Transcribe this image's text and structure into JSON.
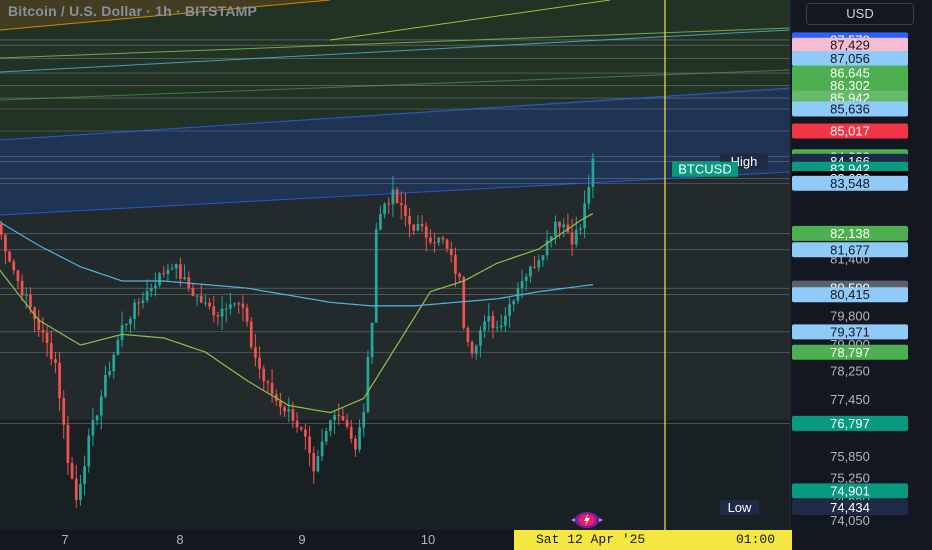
{
  "header": {
    "title": "Bitcoin / U.S. Dollar · 1h · BITSTAMP",
    "currency_button": "USD"
  },
  "crosshair": {
    "date_label": "Sat 12 Apr '25",
    "time_label": "01:00"
  },
  "colors": {
    "background": "#131722",
    "up": "#26a69a",
    "down": "#ef5350",
    "crosshair": "#f5e642",
    "ma_fast": "#8bc34a",
    "ma_slow": "#4db6e6"
  },
  "chart_data": {
    "type": "candlestick",
    "symbol": "BTCUSD",
    "x_ticks": [
      "7",
      "8",
      "9",
      "10"
    ],
    "y_ticks": [
      87578,
      87429,
      87056,
      86645,
      86302,
      85942,
      85636,
      85017,
      84293,
      84166,
      83942,
      83683,
      83548,
      82138,
      81677,
      81400,
      80599,
      80415,
      79800,
      79371,
      79000,
      78797,
      78250,
      77450,
      76797,
      75850,
      75250,
      74901,
      74650,
      74434,
      74050
    ],
    "price_labels": [
      {
        "value": 87578,
        "text": "87,578",
        "color": "#2962ff"
      },
      {
        "value": 87429,
        "text": "87,429",
        "color": "#f8bbd0"
      },
      {
        "value": 87056,
        "text": "87,056",
        "color": "#90caf9"
      },
      {
        "value": 86645,
        "text": "86,645",
        "color": "#4caf50"
      },
      {
        "value": 86302,
        "text": "86,302",
        "color": "#4caf50"
      },
      {
        "value": 85942,
        "text": "85,942",
        "color": "#66bb6a"
      },
      {
        "value": 85636,
        "text": "85,636",
        "color": "#90caf9"
      },
      {
        "value": 85017,
        "text": "85,017",
        "color": "#f23645"
      },
      {
        "value": 84293,
        "text": "84,293",
        "color": "#4caf50"
      },
      {
        "value": 84166,
        "text": "84,166",
        "color": "#1e2a46",
        "tag": "High"
      },
      {
        "value": 83942,
        "text": "83,942",
        "color": "#089981",
        "tag": "BTCUSD"
      },
      {
        "value": 83683,
        "text": "83,683",
        "color": "#000000"
      },
      {
        "value": 83548,
        "text": "83,548",
        "color": "#90caf9"
      },
      {
        "value": 82138,
        "text": "82,138",
        "color": "#4caf50"
      },
      {
        "value": 81677,
        "text": "81,677",
        "color": "#90caf9"
      },
      {
        "value": 80599,
        "text": "80,599",
        "color": "#5d606b"
      },
      {
        "value": 80415,
        "text": "80,415",
        "color": "#90caf9"
      },
      {
        "value": 79371,
        "text": "79,371",
        "color": "#90caf9"
      },
      {
        "value": 78797,
        "text": "78,797",
        "color": "#4caf50"
      },
      {
        "value": 76797,
        "text": "76,797",
        "color": "#089981"
      },
      {
        "value": 74901,
        "text": "74,901",
        "color": "#089981"
      },
      {
        "value": 74434,
        "text": "74,434",
        "color": "#1e2a46",
        "tag": "Low"
      }
    ],
    "axis_plain_labels": [
      {
        "value": 81400,
        "text": "81,400"
      },
      {
        "value": 79800,
        "text": "79,800"
      },
      {
        "value": 79000,
        "text": "79,000"
      },
      {
        "value": 78250,
        "text": "78,250"
      },
      {
        "value": 77450,
        "text": "77,450"
      },
      {
        "value": 75850,
        "text": "75,850"
      },
      {
        "value": 75250,
        "text": "75,250"
      },
      {
        "value": 74650,
        "text": "74,650"
      },
      {
        "value": 74050,
        "text": "74,050"
      }
    ],
    "horizontal_levels": [
      87578,
      87429,
      87056,
      86645,
      86302,
      85942,
      85636,
      85017,
      84293,
      84166,
      83683,
      83548,
      82138,
      81677,
      80599,
      80415,
      79371,
      78797,
      76797
    ],
    "ylim": [
      73800,
      88700
    ],
    "anchors": [
      [
        0,
        82400
      ],
      [
        5,
        80800
      ],
      [
        10,
        79500
      ],
      [
        14,
        78500
      ],
      [
        17,
        75800
      ],
      [
        19,
        74650
      ],
      [
        22,
        76300
      ],
      [
        26,
        78000
      ],
      [
        30,
        79500
      ],
      [
        34,
        80200
      ],
      [
        38,
        80800
      ],
      [
        42,
        81300
      ],
      [
        46,
        80600
      ],
      [
        50,
        80100
      ],
      [
        53,
        79900
      ],
      [
        56,
        80300
      ],
      [
        59,
        80000
      ],
      [
        61,
        79000
      ],
      [
        64,
        78000
      ],
      [
        67,
        77450
      ],
      [
        71,
        77000
      ],
      [
        74,
        76300
      ],
      [
        76,
        75300
      ],
      [
        78,
        76200
      ],
      [
        81,
        77200
      ],
      [
        84,
        76800
      ],
      [
        86,
        76000
      ],
      [
        88,
        77200
      ],
      [
        90,
        79800
      ],
      [
        91,
        82300
      ],
      [
        93,
        83000
      ],
      [
        95,
        83200
      ],
      [
        97,
        82800
      ],
      [
        99,
        82400
      ],
      [
        101,
        82300
      ],
      [
        103,
        82100
      ],
      [
        105,
        82000
      ],
      [
        107,
        81900
      ],
      [
        109,
        81400
      ],
      [
        111,
        80800
      ],
      [
        112,
        79600
      ],
      [
        114,
        78900
      ],
      [
        116,
        79400
      ],
      [
        118,
        79700
      ],
      [
        120,
        79500
      ],
      [
        122,
        79900
      ],
      [
        124,
        80400
      ],
      [
        126,
        80900
      ],
      [
        128,
        81100
      ],
      [
        130,
        81500
      ],
      [
        132,
        81900
      ],
      [
        134,
        82500
      ],
      [
        136,
        82400
      ],
      [
        138,
        82000
      ],
      [
        140,
        82300
      ],
      [
        142,
        83500
      ],
      [
        143,
        84100
      ]
    ],
    "ma_fast": [
      [
        0,
        81200
      ],
      [
        10,
        79700
      ],
      [
        20,
        79000
      ],
      [
        30,
        79300
      ],
      [
        40,
        79200
      ],
      [
        50,
        78800
      ],
      [
        60,
        78000
      ],
      [
        70,
        77300
      ],
      [
        80,
        77100
      ],
      [
        88,
        77500
      ],
      [
        96,
        79000
      ],
      [
        104,
        80500
      ],
      [
        112,
        80800
      ],
      [
        120,
        81300
      ],
      [
        130,
        81700
      ],
      [
        140,
        82500
      ],
      [
        143,
        82700
      ]
    ],
    "ma_slow": [
      [
        0,
        82500
      ],
      [
        10,
        81800
      ],
      [
        20,
        81200
      ],
      [
        30,
        80800
      ],
      [
        40,
        80800
      ],
      [
        50,
        80700
      ],
      [
        60,
        80600
      ],
      [
        70,
        80400
      ],
      [
        80,
        80200
      ],
      [
        90,
        80100
      ],
      [
        100,
        80100
      ],
      [
        110,
        80200
      ],
      [
        120,
        80300
      ],
      [
        130,
        80500
      ],
      [
        143,
        80700
      ]
    ],
    "candle_count": 144
  }
}
